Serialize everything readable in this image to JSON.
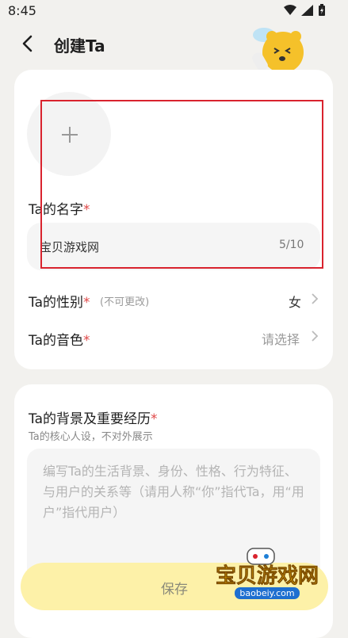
{
  "status_bar": {
    "time": "8:45"
  },
  "header": {
    "title": "创建Ta"
  },
  "form": {
    "name": {
      "label": "Ta的名字",
      "required_mark": "*",
      "value": "宝贝游戏网",
      "counter": "5/10"
    },
    "gender": {
      "label": "Ta的性别",
      "required_mark": "*",
      "hint": "(不可更改)",
      "value": "女"
    },
    "voice": {
      "label": "Ta的音色",
      "required_mark": "*",
      "placeholder": "请选择"
    },
    "background": {
      "label": "Ta的背景及重要经历",
      "required_mark": "*",
      "subtitle": "Ta的核心人设，不对外展示",
      "placeholder": "编写Ta的生活背景、身份、性格、行为特征、与用户的关系等（请用人称“你”指代Ta，用“用户”指代用户）"
    }
  },
  "actions": {
    "save": "保存"
  },
  "watermark": {
    "text": "宝贝游戏网",
    "url": "baobeiy.com"
  },
  "colors": {
    "required": "#e04848",
    "save_bg": "#fdf1a8",
    "highlight": "#d9232e"
  }
}
